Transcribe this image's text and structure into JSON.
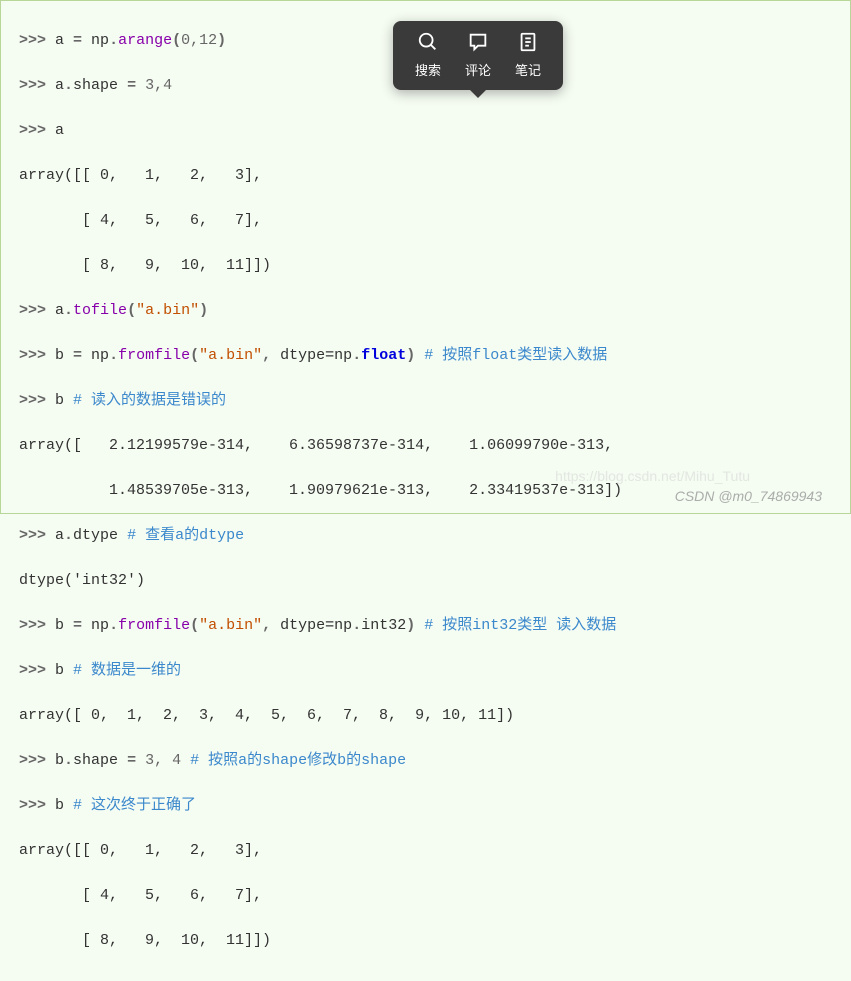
{
  "prompt": ">>> ",
  "toolbar": {
    "search_label": "搜索",
    "comment_label": "评论",
    "note_label": "笔记"
  },
  "code": {
    "l1_a": "a ",
    "l1_eq": "= ",
    "l1_np": "np",
    "l1_dot": ".",
    "l1_fn": "arange",
    "l1_open": "(",
    "l1_arg": "0,12",
    "l1_close": ")",
    "l2_a": "a",
    "l2_dot": ".",
    "l2_shape": "shape ",
    "l2_eq": "= ",
    "l2_val": "3,4",
    "l3_a": "a",
    "l4": "array([[ 0,   1,   2,   3],",
    "l5": "       [ 4,   5,   6,   7],",
    "l6": "       [ 8,   9,  10,  11]])",
    "l7_a": "a",
    "l7_dot": ".",
    "l7_fn": "tofile",
    "l7_open": "(",
    "l7_str": "\"a.bin\"",
    "l7_close": ")",
    "l8_b": "b ",
    "l8_eq": "= ",
    "l8_np": "np",
    "l8_dot": ".",
    "l8_fn": "fromfile",
    "l8_open": "(",
    "l8_str": "\"a.bin\"",
    "l8_comma": ", ",
    "l8_kwarg": "dtype",
    "l8_eq2": "=",
    "l8_np2": "np",
    "l8_dot2": ".",
    "l8_float": "float",
    "l8_close": ")",
    "l8_comment": " # 按照float类型读入数据",
    "l9_b": "b ",
    "l9_comment": "# 读入的数据是错误的",
    "l10": "array([   2.12199579e-314,    6.36598737e-314,    1.06099790e-313,",
    "l11": "          1.48539705e-313,    1.90979621e-313,    2.33419537e-313])",
    "l12_a": "a",
    "l12_dot": ".",
    "l12_dtype": "dtype ",
    "l12_comment": "# 查看a的dtype",
    "l13": "dtype('int32')",
    "l14_b": "b ",
    "l14_eq": "= ",
    "l14_np": "np",
    "l14_dot": ".",
    "l14_fn": "fromfile",
    "l14_open": "(",
    "l14_str": "\"a.bin\"",
    "l14_comma": ", ",
    "l14_kwarg": "dtype",
    "l14_eq2": "=",
    "l14_np2": "np",
    "l14_dot2": ".",
    "l14_int32": "int32",
    "l14_close": ")",
    "l14_comment": " # 按照int32类型 读入数据",
    "l15_b": "b ",
    "l15_comment": "# 数据是一维的",
    "l16": "array([ 0,  1,  2,  3,  4,  5,  6,  7,  8,  9, 10, 11])",
    "l17_b": "b",
    "l17_dot": ".",
    "l17_shape": "shape ",
    "l17_eq": "= ",
    "l17_val": "3, 4 ",
    "l17_comment": "# 按照a的shape修改b的shape",
    "l18_b": "b ",
    "l18_comment": "# 这次终于正确了",
    "l19": "array([[ 0,   1,   2,   3],",
    "l20": "       [ 4,   5,   6,   7],",
    "l21": "       [ 8,   9,  10,  11]])"
  },
  "watermark": "CSDN @m0_74869943",
  "watermark2": "https://blog.csdn.net/Mihu_Tutu"
}
